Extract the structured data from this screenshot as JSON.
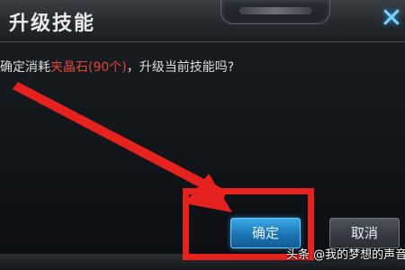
{
  "dialog": {
    "title": "升级技能",
    "close_glyph": "✕",
    "message_prefix": "确定消耗",
    "message_item": "夹晶石(90个)",
    "message_suffix": "，升级当前技能吗?",
    "highlight_color": "#e0453a"
  },
  "buttons": {
    "confirm_label": "确定",
    "cancel_label": "取消"
  },
  "annotation": {
    "arrow_color": "#e6221e",
    "box_color": "#e6221e"
  },
  "watermark": {
    "text": "头条 @我的梦想的声音"
  }
}
